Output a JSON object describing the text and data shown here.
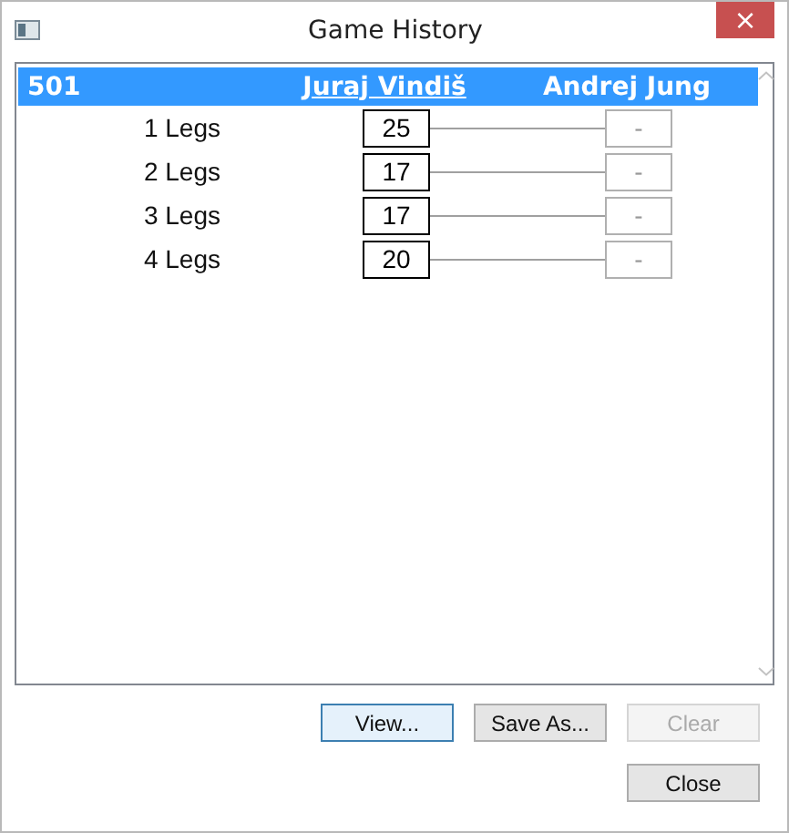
{
  "window": {
    "title": "Game History",
    "close": "×"
  },
  "header": {
    "game": "501",
    "players": [
      {
        "name": "Juraj Vindiš",
        "selected": true
      },
      {
        "name": "Andrej Jung",
        "selected": false
      }
    ]
  },
  "rows": [
    {
      "label": "1 Legs",
      "scores": [
        {
          "value": "25",
          "disabled": false
        },
        {
          "value": "-",
          "disabled": true
        }
      ]
    },
    {
      "label": "2 Legs",
      "scores": [
        {
          "value": "17",
          "disabled": false
        },
        {
          "value": "-",
          "disabled": true
        }
      ]
    },
    {
      "label": "3 Legs",
      "scores": [
        {
          "value": "17",
          "disabled": false
        },
        {
          "value": "-",
          "disabled": true
        }
      ]
    },
    {
      "label": "4 Legs",
      "scores": [
        {
          "value": "20",
          "disabled": false
        },
        {
          "value": "-",
          "disabled": true
        }
      ]
    }
  ],
  "buttons": [
    {
      "label": "View...",
      "focused": true,
      "disabled": false
    },
    {
      "label": "Save As...",
      "focused": false,
      "disabled": false
    },
    {
      "label": "Clear",
      "focused": false,
      "disabled": true
    }
  ],
  "close_button": {
    "label": "Close",
    "disabled": false
  }
}
